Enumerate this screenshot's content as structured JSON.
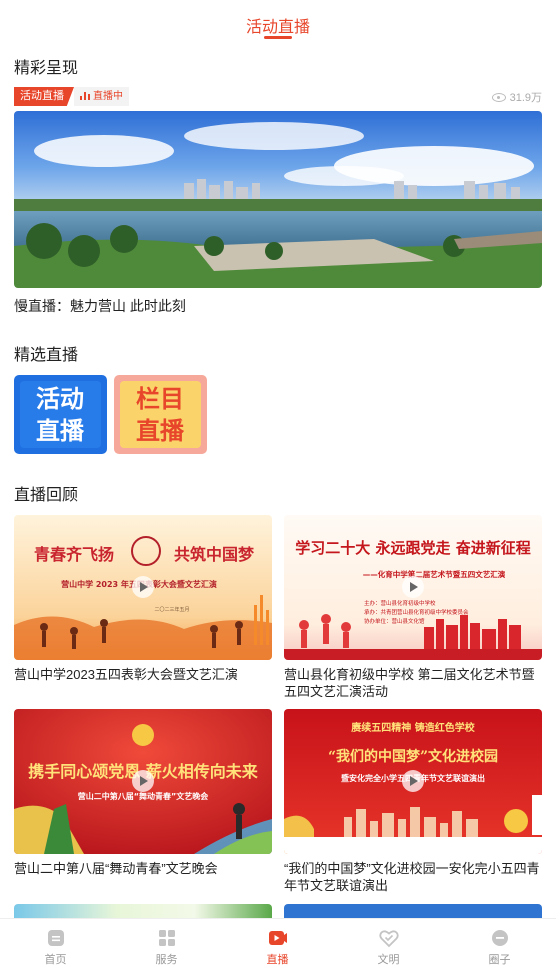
{
  "header": {
    "title": "活动直播"
  },
  "featured": {
    "section_title": "精彩呈现",
    "badge_label": "活动直播",
    "live_status": "直播中",
    "views": "31.9万",
    "caption": "慢直播：魅力营山 此时此刻"
  },
  "selected": {
    "section_title": "精选直播",
    "tiles": [
      {
        "line1": "活动",
        "line2": "直播"
      },
      {
        "line1": "栏目",
        "line2": "直播"
      }
    ]
  },
  "replay": {
    "section_title": "直播回顾",
    "items": [
      {
        "title": "营山中学2023五四表彰大会暨文艺汇演",
        "banner_left": "青春齐飞扬",
        "banner_right": "共筑中国梦",
        "banner_sub": "营山中学 2023 年五四表彰大会暨文艺汇演",
        "banner_date": "二〇二三年五月"
      },
      {
        "title": "营山县化育初级中学校 第二届文化艺术节暨五四文艺汇演活动",
        "banner_main": "学习二十大 永远跟党走 奋进新征程",
        "banner_sub": "——化育中学第二届艺术节暨五四文艺汇演",
        "banner_org1": "主办：营山县化育初级中学校",
        "banner_org2": "承办：共青团营山县化育初级中学校委员会",
        "banner_org3": "协办单位：营山县文化馆"
      },
      {
        "title": "营山二中第八届“舞动青春”文艺晚会",
        "banner_main": "携手同心颂党恩 薪火相传向未来",
        "banner_sub": "营山二中第八届“舞动青春”文艺晚会"
      },
      {
        "title": "“我们的中国梦”文化进校园一安化完小五四青年节文艺联谊演出",
        "banner_top": "赓续五四精神 铸造红色学校",
        "banner_main": "“我们的中国梦”文化进校园",
        "banner_sub": "暨安化完全小学五四青年节文艺联谊演出"
      }
    ]
  },
  "tabbar": {
    "tabs": [
      {
        "label": "首页"
      },
      {
        "label": "服务"
      },
      {
        "label": "直播"
      },
      {
        "label": "文明"
      },
      {
        "label": "圈子"
      }
    ],
    "active_color": "#e8462b",
    "inactive_color": "#999999"
  }
}
